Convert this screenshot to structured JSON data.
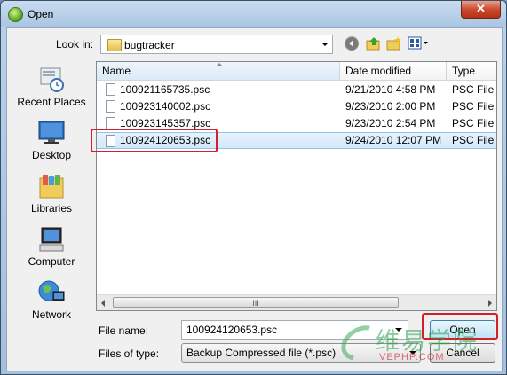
{
  "window": {
    "title": "Open",
    "close_glyph": "✕"
  },
  "toolbar": {
    "look_in_label": "Look in:",
    "look_in_value": "bugtracker"
  },
  "places": [
    {
      "label": "Recent Places",
      "icon": "recent-places-icon"
    },
    {
      "label": "Desktop",
      "icon": "desktop-icon"
    },
    {
      "label": "Libraries",
      "icon": "libraries-icon"
    },
    {
      "label": "Computer",
      "icon": "computer-icon"
    },
    {
      "label": "Network",
      "icon": "network-icon"
    }
  ],
  "file_list": {
    "columns": {
      "name": "Name",
      "date": "Date modified",
      "type": "Type"
    },
    "rows": [
      {
        "name": "100921165735.psc",
        "date": "9/21/2010 4:58 PM",
        "type": "PSC File"
      },
      {
        "name": "100923140002.psc",
        "date": "9/23/2010 2:00 PM",
        "type": "PSC File"
      },
      {
        "name": "100923145357.psc",
        "date": "9/23/2010 2:54 PM",
        "type": "PSC File"
      },
      {
        "name": "100924120653.psc",
        "date": "9/24/2010 12:07 PM",
        "type": "PSC File"
      }
    ],
    "selected_index": 3,
    "scroll_thumb_glyph": "III"
  },
  "bottom": {
    "file_name_label": "File name:",
    "file_name_value": "100924120653.psc",
    "file_type_label": "Files of type:",
    "file_type_value": "Backup Compressed file (*.psc)",
    "open_label": "Open",
    "cancel_label": "Cancel"
  },
  "watermark": {
    "cn": "维易学院",
    "en": "VEPHP.COM"
  },
  "colors": {
    "highlight_box": "#d0202a",
    "selection": "#d2e8fb"
  }
}
